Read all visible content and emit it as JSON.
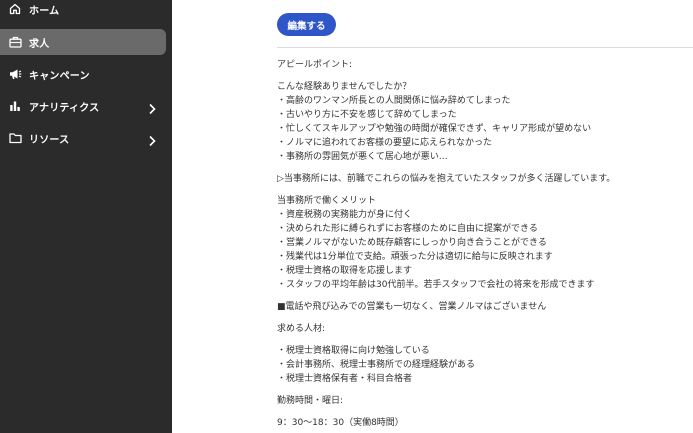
{
  "sidebar": {
    "items": [
      {
        "label": "ホーム",
        "icon": "home-icon"
      },
      {
        "label": "求人",
        "icon": "briefcase-icon",
        "active": true
      },
      {
        "label": "キャンペーン",
        "icon": "megaphone-icon"
      },
      {
        "label": "アナリティクス",
        "icon": "bar-chart-icon",
        "has_submenu": true
      },
      {
        "label": "リソース",
        "icon": "folder-icon",
        "has_submenu": true
      }
    ]
  },
  "main": {
    "edit_button_label": "編集する",
    "lines": [
      "アピールポイント:",
      "こんな経験ありませんでしたか？",
      "・高齢のワンマン所長との人間関係に悩み辞めてしまった",
      "・古いやり方に不安を感じて辞めてしまった",
      "・忙しくてスキルアップや勉強の時間が確保できず、キャリア形成が望めない",
      "・ノルマに追われてお客様の要望に応えられなかった",
      "・事務所の雰囲気が悪くて居心地が悪い…",
      "▷当事務所には、前職でこれらの悩みを抱えていたスタッフが多く活躍しています。",
      "当事務所で働くメリット",
      "・資産税務の実務能力が身に付く",
      "・決められた形に縛られずにお客様のために自由に提案ができる",
      "・営業ノルマがないため既存顧客にしっかり向き合うことができる",
      "・残業代は1分単位で支給。頑張った分は適切に給与に反映されます",
      "・税理士資格の取得を応援します",
      "・スタッフの平均年齢は30代前半。若手スタッフで会社の将来を形成できます",
      "■電話や飛び込みでの営業も一切なく、営業ノルマはございません",
      "求める人材:",
      "・税理士資格取得に向け勉強している",
      "・会計事務所、税理士事務所での経理経験がある",
      "・税理士資格保有者・科目合格者",
      "勤務時間・曜日:",
      "9：30〜18：30（実働8時間）"
    ]
  },
  "colors": {
    "sidebar_bg": "#2b2b2b",
    "sidebar_active": "#6a6a6a",
    "accent": "#2f56c8",
    "text": "#333333"
  }
}
